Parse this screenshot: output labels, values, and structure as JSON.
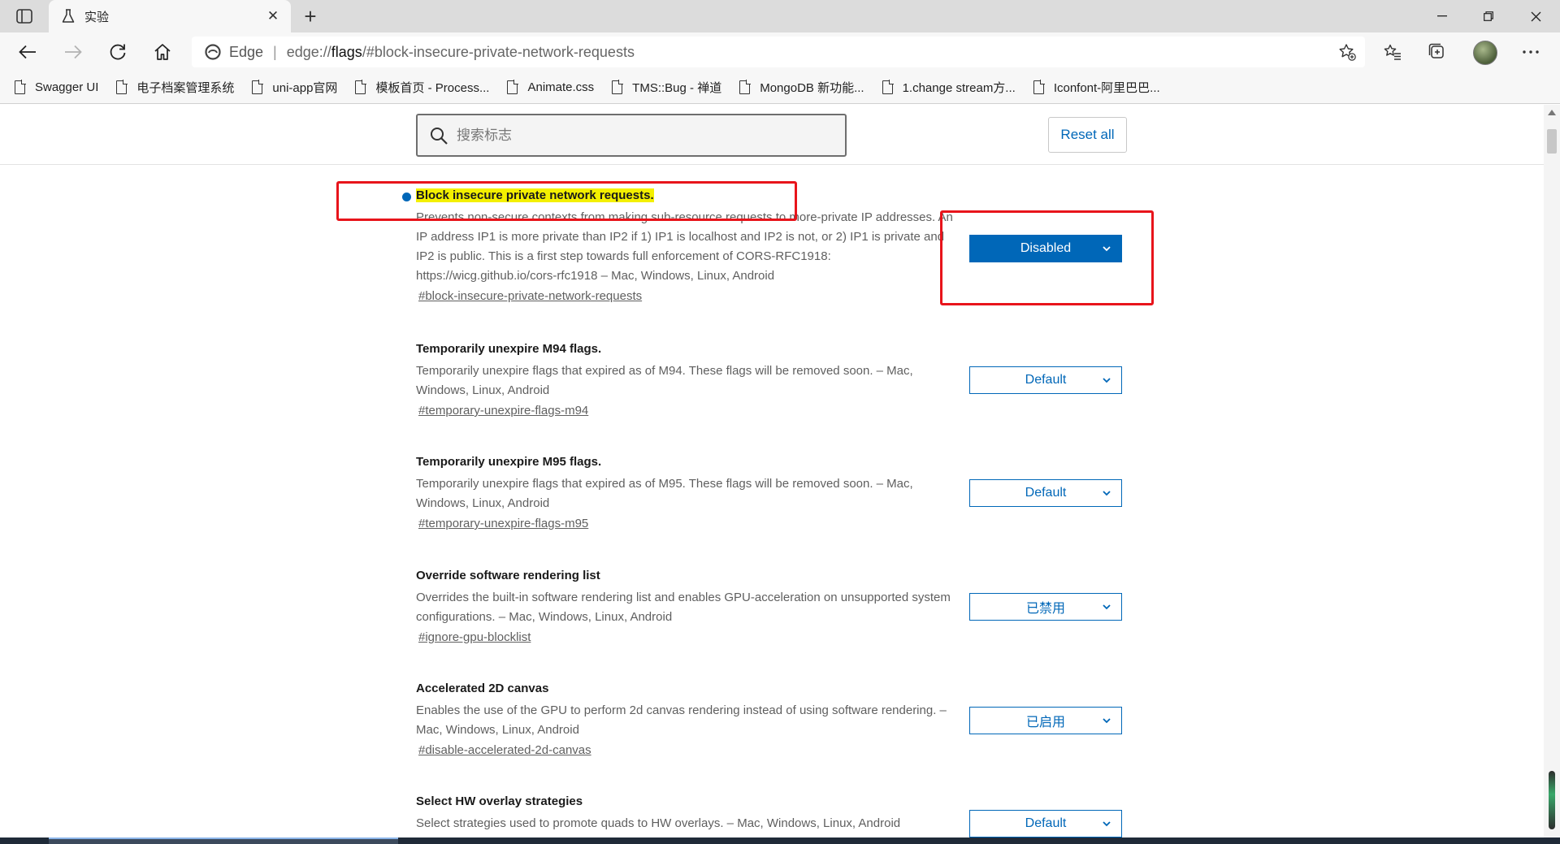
{
  "tab": {
    "title": "实验"
  },
  "address": {
    "scheme_label": "Edge",
    "url_prefix": "edge://",
    "url_host": "flags",
    "url_rest": "/#block-insecure-private-network-requests"
  },
  "bookmarks": [
    {
      "label": "Swagger UI"
    },
    {
      "label": "电子档案管理系统"
    },
    {
      "label": "uni-app官网"
    },
    {
      "label": "模板首页 - Process..."
    },
    {
      "label": "Animate.css"
    },
    {
      "label": "TMS::Bug - 禅道"
    },
    {
      "label": "MongoDB 新功能..."
    },
    {
      "label": "1.change stream方..."
    },
    {
      "label": "Iconfont-阿里巴巴..."
    }
  ],
  "search": {
    "placeholder": "搜索标志"
  },
  "reset_label": "Reset all",
  "flags": [
    {
      "title": "Block insecure private network requests.",
      "desc": "Prevents non-secure contexts from making sub-resource requests to more-private IP addresses. An IP address IP1 is more private than IP2 if 1) IP1 is localhost and IP2 is not, or 2) IP1 is private and IP2 is public. This is a first step towards full enforcement of CORS-RFC1918: https://wicg.github.io/cors-rfc1918 – Mac, Windows, Linux, Android",
      "link": "#block-insecure-private-network-requests",
      "value": "Disabled"
    },
    {
      "title": "Temporarily unexpire M94 flags.",
      "desc": "Temporarily unexpire flags that expired as of M94. These flags will be removed soon. – Mac, Windows, Linux, Android",
      "link": "#temporary-unexpire-flags-m94",
      "value": "Default"
    },
    {
      "title": "Temporarily unexpire M95 flags.",
      "desc": "Temporarily unexpire flags that expired as of M95. These flags will be removed soon. – Mac, Windows, Linux, Android",
      "link": "#temporary-unexpire-flags-m95",
      "value": "Default"
    },
    {
      "title": "Override software rendering list",
      "desc": "Overrides the built-in software rendering list and enables GPU-acceleration on unsupported system configurations. – Mac, Windows, Linux, Android",
      "link": "#ignore-gpu-blocklist",
      "value": "已禁用"
    },
    {
      "title": "Accelerated 2D canvas",
      "desc": "Enables the use of the GPU to perform 2d canvas rendering instead of using software rendering. – Mac, Windows, Linux, Android",
      "link": "#disable-accelerated-2d-canvas",
      "value": "已启用"
    },
    {
      "title": "Select HW overlay strategies",
      "desc": "Select strategies used to promote quads to HW overlays. – Mac, Windows, Linux, Android",
      "value": "Default"
    }
  ],
  "colors": {
    "accent": "#0067b8",
    "highlight": "#f4f000",
    "annotation": "#e8141b"
  }
}
